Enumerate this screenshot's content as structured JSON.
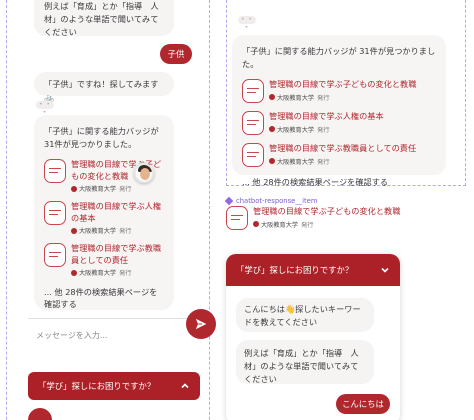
{
  "left_chat": {
    "bot_msg_top": "例えば「育成」とか「指導　人材」のような単語で聞いてみてください",
    "user_msg": "子供",
    "bot_reply": "「子供」ですね！探してみます🚲",
    "typing_dots": "• • •",
    "result_intro": "「子供」に関する能力バッジが 31件が見つかりました。",
    "results": [
      {
        "title": "管理職の目線で学ぶ子どもの変化と教職",
        "issuer": "大阪教育大学",
        "issued": "発行"
      },
      {
        "title": "管理職の目線で学ぶ人権の基本",
        "issuer": "大阪教育大学",
        "issued": "発行"
      },
      {
        "title": "管理職の目線で学ぶ教職員としての責任",
        "issuer": "大阪教育大学",
        "issued": "発行"
      }
    ],
    "more_link": "... 他 28件の検索結果ページを確認する",
    "input_placeholder": "メッセージを入力...",
    "header_title": "「学び」探しにお困りですか？"
  },
  "right_chat": {
    "typing_dots": "• • •",
    "result_intro": "「子供」に関する能力バッジが 31件が見つかりました。",
    "results": [
      {
        "title": "管理職の目線で学ぶ子どもの変化と教職",
        "issuer": "大阪教育大学",
        "issued": "発行"
      },
      {
        "title": "管理職の目線で学ぶ人権の基本",
        "issuer": "大阪教育大学",
        "issued": "発行"
      },
      {
        "title": "管理職の目線で学ぶ教職員としての責任",
        "issuer": "大阪教育大学",
        "issued": "発行"
      }
    ],
    "more_link": "... 他 28件の検索結果ページを確認する",
    "component_label": "chatbot-response__item",
    "item_title": "管理職の目線で学ぶ子どもの変化と教職",
    "item_issuer": "大阪教育大学",
    "item_issued": "発行",
    "header_title": "「学び」探しにお困りですか？",
    "greeting": "こんにちは👋探したいキーワードを教えてください",
    "example": "例えば「育成」とか「指導　人材」のような単語で聞いてみてください",
    "user_msg": "こんにちは"
  },
  "colors": {
    "brand": "#b0272e",
    "bubble": "#f6f3f3",
    "frame": "#b9a6ee"
  },
  "icons": {
    "send": "send-icon",
    "chevron": "chevron-down-icon",
    "badge": "badge-icon"
  }
}
